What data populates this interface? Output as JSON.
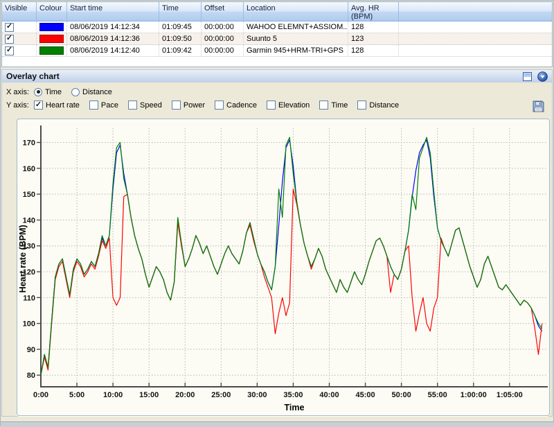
{
  "table": {
    "columns": [
      "Visible",
      "Colour",
      "Start time",
      "Time",
      "Offset",
      "Location"
    ],
    "avg_hr_header": {
      "line1": "Avg. HR",
      "line2": "(BPM)"
    },
    "rows": [
      {
        "visible": true,
        "colour": "#0000FF",
        "start_time": "08/06/2019 14:12:34",
        "time": "01:09:45",
        "offset": "00:00:00",
        "location": "WAHOO  ELEMNT+ASSIOM...",
        "avg_hr": "128"
      },
      {
        "visible": true,
        "colour": "#FF0000",
        "start_time": "08/06/2019 14:12:36",
        "time": "01:09:50",
        "offset": "00:00:00",
        "location": "Suunto 5",
        "avg_hr": "123"
      },
      {
        "visible": true,
        "colour": "#008000",
        "start_time": "08/06/2019 14:12:40",
        "time": "01:09:42",
        "offset": "00:00:00",
        "location": "Garmin 945+HRM-TRI+GPS",
        "avg_hr": "128"
      }
    ]
  },
  "overlay": {
    "title": "Overlay chart",
    "x_label": "X axis:",
    "y_label": "Y axis:",
    "x_options": [
      {
        "label": "Time",
        "selected": true
      },
      {
        "label": "Distance",
        "selected": false
      }
    ],
    "y_options": [
      {
        "label": "Heart rate",
        "checked": true
      },
      {
        "label": "Pace",
        "checked": false
      },
      {
        "label": "Speed",
        "checked": false
      },
      {
        "label": "Power",
        "checked": false
      },
      {
        "label": "Cadence",
        "checked": false
      },
      {
        "label": "Elevation",
        "checked": false
      },
      {
        "label": "Time",
        "checked": false
      },
      {
        "label": "Distance",
        "checked": false
      }
    ]
  },
  "chart_data": {
    "type": "line",
    "title": "",
    "xlabel": "Time",
    "ylabel": "Heart rate (BPM)",
    "x_unit": "minutes",
    "x_start": 0,
    "x_step": 0.5,
    "xlim": [
      0,
      70.3
    ],
    "ylim": [
      75.5,
      175.5
    ],
    "grid": true,
    "legend_position": "none",
    "x_ticks": [
      {
        "t": 0,
        "label": "0:00"
      },
      {
        "t": 5,
        "label": "5:00"
      },
      {
        "t": 10,
        "label": "10:00"
      },
      {
        "t": 15,
        "label": "15:00"
      },
      {
        "t": 20,
        "label": "20:00"
      },
      {
        "t": 25,
        "label": "25:00"
      },
      {
        "t": 30,
        "label": "30:00"
      },
      {
        "t": 35,
        "label": "35:00"
      },
      {
        "t": 40,
        "label": "40:00"
      },
      {
        "t": 45,
        "label": "45:00"
      },
      {
        "t": 50,
        "label": "50:00"
      },
      {
        "t": 55,
        "label": "55:00"
      },
      {
        "t": 60,
        "label": "1:00:00"
      },
      {
        "t": 65,
        "label": "1:05:00"
      }
    ],
    "y_ticks": [
      80,
      90,
      100,
      110,
      120,
      130,
      140,
      150,
      160,
      170
    ],
    "series": [
      {
        "name": "WAHOO ELEMNT+ASSIOMA",
        "color": "#0000FF",
        "values": [
          80,
          88,
          83,
          101,
          118,
          123,
          125,
          118,
          111,
          121,
          125,
          123,
          119,
          121,
          124,
          122,
          127,
          133,
          130,
          134,
          152,
          166,
          169,
          158,
          150,
          141,
          134,
          129,
          125,
          119,
          114,
          118,
          122,
          120,
          117,
          112,
          109,
          116,
          140,
          131,
          122,
          125,
          129,
          134,
          131,
          127,
          130,
          126,
          122,
          119,
          123,
          127,
          130,
          127,
          125,
          123,
          128,
          135,
          139,
          133,
          127,
          123,
          120,
          116,
          113,
          122,
          138,
          155,
          168,
          171,
          161,
          147,
          138,
          131,
          126,
          122,
          125,
          129,
          126,
          121,
          118,
          115,
          112,
          117,
          114,
          112,
          116,
          120,
          117,
          115,
          119,
          124,
          128,
          132,
          133,
          130,
          126,
          122,
          119,
          117,
          121,
          128,
          136,
          149,
          159,
          166,
          169,
          171,
          164,
          149,
          137,
          132,
          129,
          126,
          131,
          136,
          137,
          132,
          127,
          122,
          118,
          114,
          117,
          123,
          126,
          122,
          118,
          114,
          113,
          115,
          113,
          111,
          109,
          107,
          109,
          108,
          106,
          103,
          99,
          97
        ]
      },
      {
        "name": "Suunto 5",
        "color": "#FF0000",
        "values": [
          80,
          87,
          82,
          100,
          117,
          122,
          124,
          117,
          110,
          120,
          124,
          122,
          118,
          120,
          123,
          121,
          126,
          132,
          129,
          133,
          110,
          107,
          110,
          149,
          150,
          141,
          134,
          129,
          125,
          119,
          114,
          118,
          122,
          120,
          117,
          112,
          109,
          116,
          139,
          130,
          122,
          125,
          129,
          134,
          131,
          127,
          130,
          126,
          122,
          119,
          123,
          127,
          130,
          127,
          125,
          123,
          128,
          135,
          138,
          132,
          127,
          123,
          118,
          114,
          110,
          96,
          104,
          110,
          103,
          108,
          152,
          146,
          138,
          131,
          126,
          121,
          125,
          129,
          126,
          121,
          118,
          115,
          112,
          117,
          114,
          112,
          116,
          120,
          117,
          115,
          119,
          124,
          128,
          132,
          133,
          130,
          126,
          112,
          119,
          117,
          121,
          128,
          130,
          110,
          97,
          104,
          110,
          100,
          97,
          106,
          110,
          133,
          129,
          126,
          131,
          136,
          137,
          132,
          127,
          122,
          118,
          114,
          117,
          123,
          126,
          122,
          118,
          114,
          113,
          115,
          113,
          111,
          109,
          107,
          109,
          108,
          106,
          98,
          88,
          100
        ]
      },
      {
        "name": "Garmin 945+HRM-TRI+GPS",
        "color": "#008000",
        "values": [
          80,
          88,
          83,
          101,
          118,
          123,
          125,
          118,
          111,
          121,
          125,
          123,
          119,
          121,
          124,
          122,
          127,
          134,
          130,
          134,
          154,
          168,
          170,
          156,
          150,
          141,
          134,
          129,
          125,
          119,
          114,
          118,
          122,
          120,
          117,
          112,
          109,
          116,
          141,
          131,
          122,
          125,
          129,
          134,
          131,
          127,
          130,
          126,
          122,
          119,
          123,
          127,
          130,
          127,
          125,
          123,
          128,
          135,
          139,
          133,
          127,
          123,
          120,
          116,
          113,
          122,
          152,
          141,
          169,
          172,
          158,
          147,
          138,
          131,
          126,
          122,
          125,
          129,
          126,
          121,
          118,
          115,
          112,
          117,
          114,
          112,
          116,
          120,
          117,
          115,
          119,
          124,
          128,
          132,
          133,
          130,
          126,
          122,
          119,
          117,
          121,
          128,
          136,
          150,
          144,
          164,
          168,
          172,
          166,
          151,
          137,
          132,
          129,
          126,
          131,
          136,
          137,
          132,
          127,
          122,
          118,
          114,
          117,
          123,
          126,
          122,
          118,
          114,
          113,
          115,
          113,
          111,
          109,
          107,
          109,
          108,
          106,
          103,
          100,
          98
        ]
      }
    ]
  }
}
